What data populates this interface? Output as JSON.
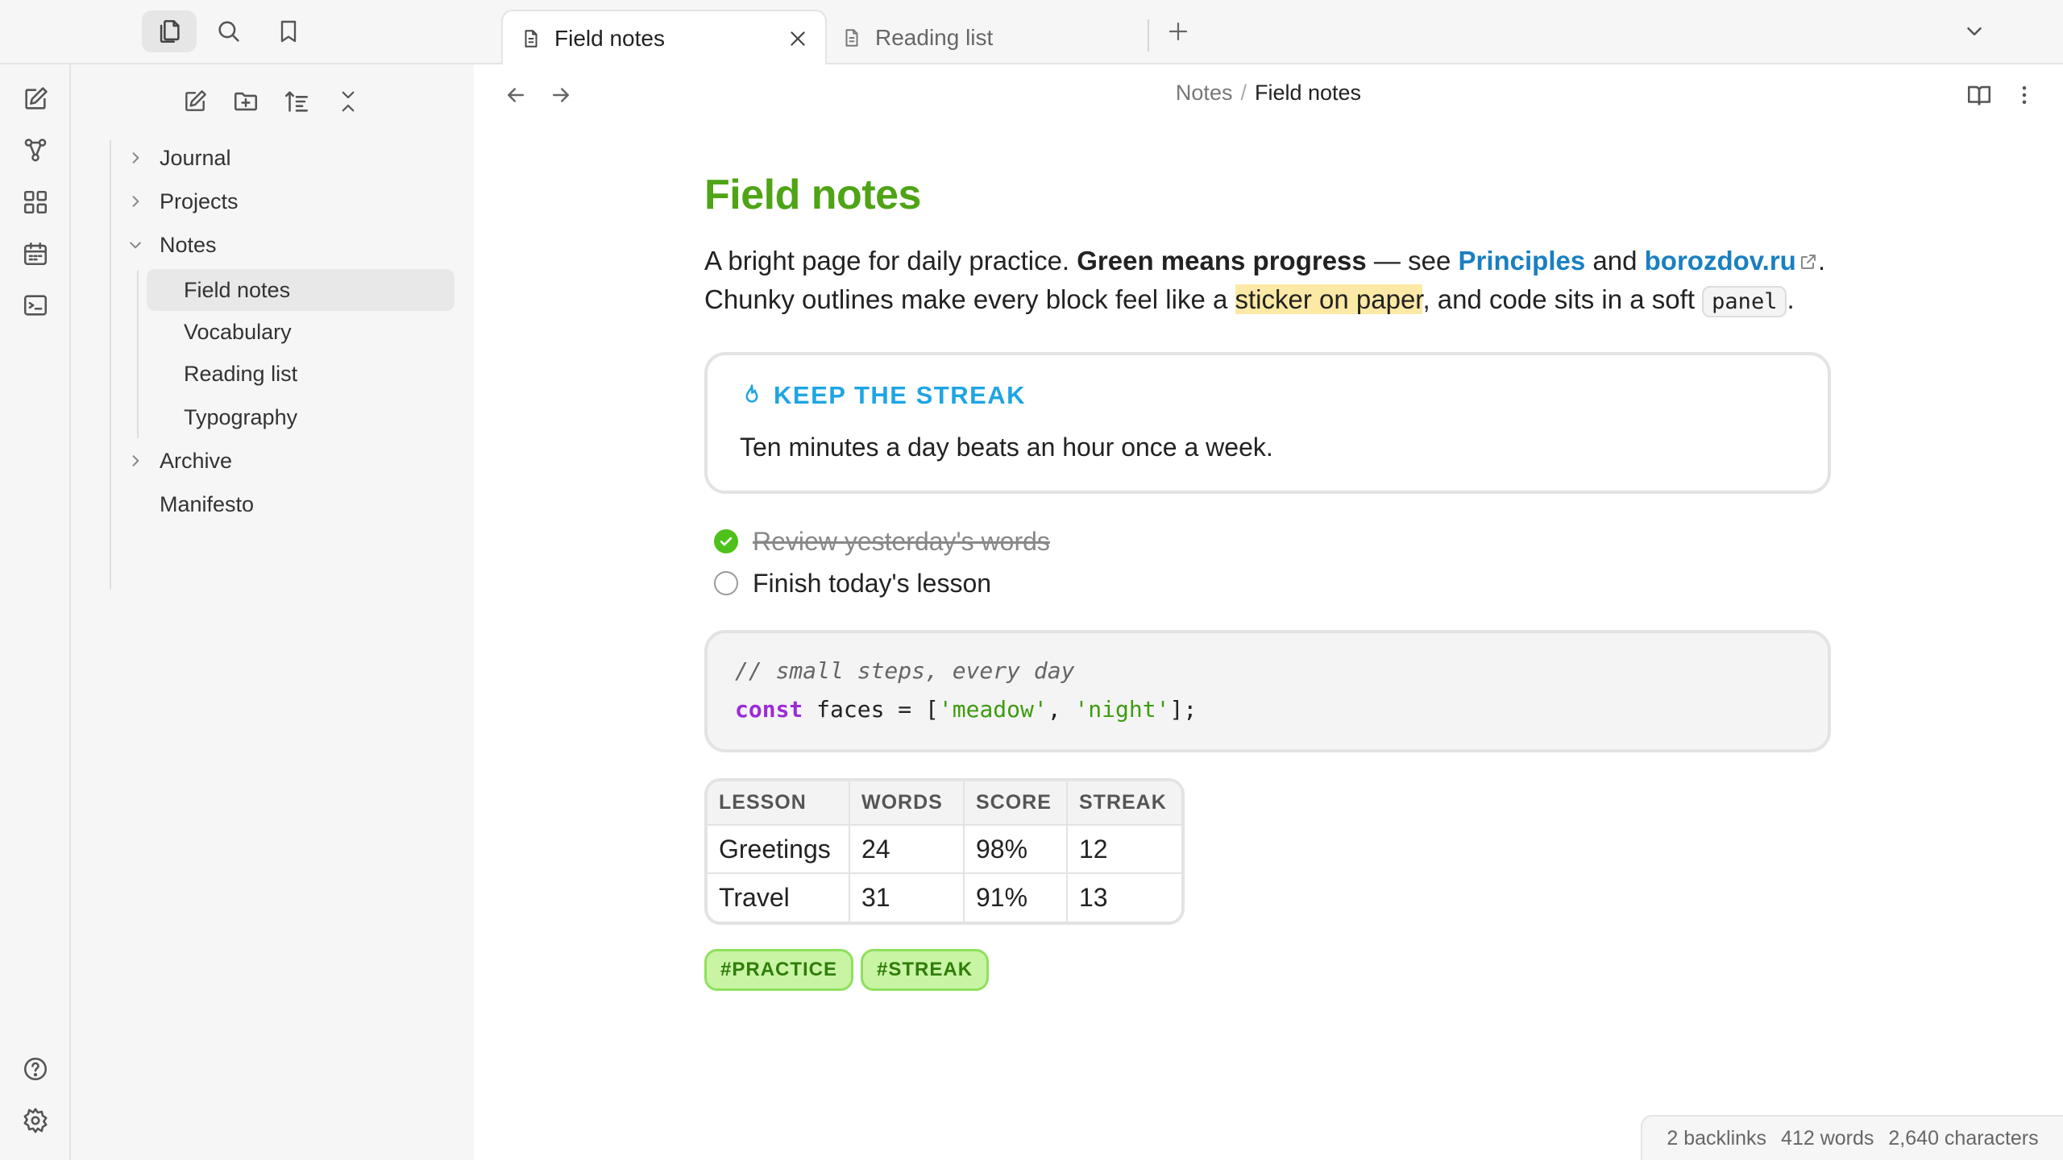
{
  "tabs": [
    {
      "label": "Field notes",
      "active": true
    },
    {
      "label": "Reading list",
      "active": false
    }
  ],
  "tabbar_icons": [
    "files-icon",
    "search-icon",
    "bookmark-icon"
  ],
  "ribbon": {
    "top": [
      "new-note-icon",
      "graph-icon",
      "dashboard-icon",
      "calendar-icon",
      "terminal-icon"
    ],
    "bottom": [
      "help-icon",
      "settings-icon"
    ]
  },
  "sidebar": {
    "tools": [
      "new-note-icon",
      "new-folder-icon",
      "sort-icon",
      "collapse-all-icon"
    ],
    "tree": [
      {
        "label": "Journal",
        "type": "folder",
        "expanded": false
      },
      {
        "label": "Projects",
        "type": "folder",
        "expanded": false
      },
      {
        "label": "Notes",
        "type": "folder",
        "expanded": true
      },
      {
        "label": "Field notes",
        "type": "file",
        "selected": true
      },
      {
        "label": "Vocabulary",
        "type": "file"
      },
      {
        "label": "Reading list",
        "type": "file"
      },
      {
        "label": "Typography",
        "type": "file"
      },
      {
        "label": "Archive",
        "type": "folder",
        "expanded": false
      },
      {
        "label": "Manifesto",
        "type": "file"
      }
    ]
  },
  "breadcrumb": {
    "parent": "Notes",
    "separator": "/",
    "current": "Field notes"
  },
  "doc": {
    "title": "Field notes",
    "p1": {
      "a": "A bright page for daily practice. ",
      "bold": "Green means progress",
      "b": " — see ",
      "link_internal": "Principles",
      "c": " and ",
      "link_external": "borozdov.ru",
      "d": "."
    },
    "p2": {
      "a": "Chunky outlines make every block feel like a ",
      "highlight": "sticker on paper",
      "b": ", and code sits in a soft ",
      "code": "panel",
      "c": "."
    },
    "callout": {
      "title": "KEEP THE STREAK",
      "body": "Ten minutes a day beats an hour once a week."
    },
    "tasks": [
      {
        "label": "Review yesterday's words",
        "done": true
      },
      {
        "label": "Finish today's lesson",
        "done": false
      }
    ],
    "code": {
      "comment": "// small steps, every day",
      "keyword": "const",
      "plain1": " faces = [",
      "str1": "'meadow'",
      "plain2": ", ",
      "str2": "'night'",
      "plain3": "];"
    },
    "table": {
      "headers": [
        "LESSON",
        "WORDS",
        "SCORE",
        "STREAK"
      ],
      "rows": [
        [
          "Greetings",
          "24",
          "98%",
          "12"
        ],
        [
          "Travel",
          "31",
          "91%",
          "13"
        ]
      ]
    },
    "tags": [
      "#PRACTICE",
      "#STREAK"
    ]
  },
  "status": {
    "backlinks": "2 backlinks",
    "words": "412 words",
    "characters": "2,640 characters"
  },
  "colors": {
    "accent_green": "#4ea415",
    "link_blue": "#1a7fc1",
    "callout_blue": "#1ea5e3",
    "highlight": "#fde9a6",
    "tag_bg": "#c8f4a4"
  }
}
